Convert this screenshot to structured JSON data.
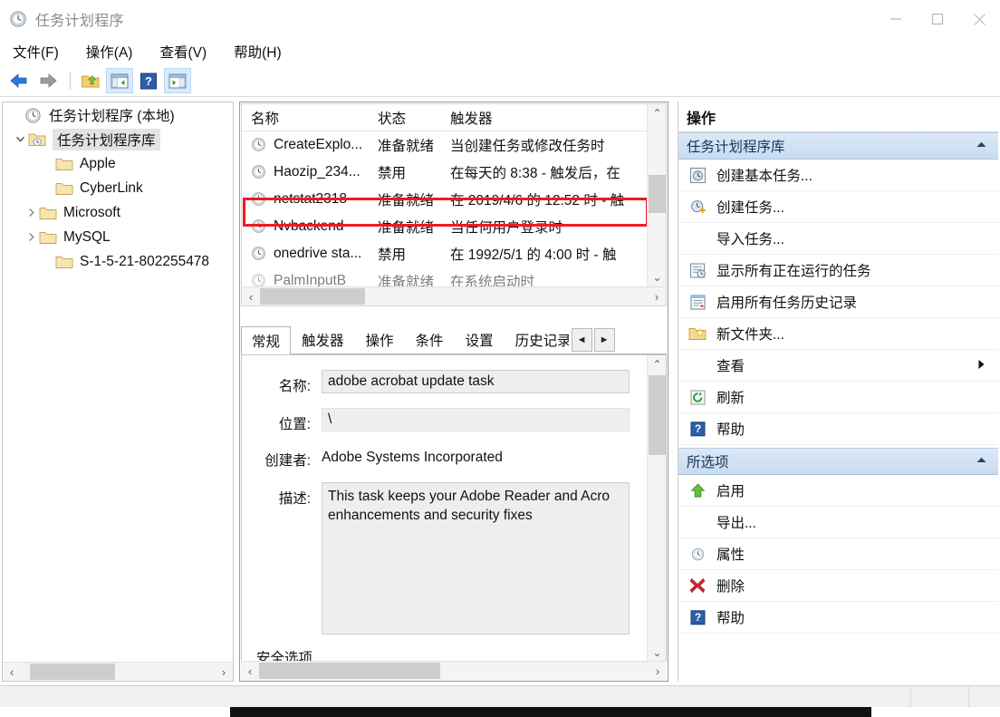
{
  "window": {
    "title": "任务计划程序",
    "title_icon": "clock-icon",
    "minimize_label": "最小化",
    "maximize_label": "最大化",
    "close_label": "关闭"
  },
  "menubar": {
    "items": [
      {
        "label": "文件(F)",
        "name": "menu-file"
      },
      {
        "label": "操作(A)",
        "name": "menu-action"
      },
      {
        "label": "查看(V)",
        "name": "menu-view"
      },
      {
        "label": "帮助(H)",
        "name": "menu-help"
      }
    ]
  },
  "toolbar": {
    "buttons": [
      {
        "icon": "back-arrow-icon",
        "name": "toolbar-back",
        "selected": false
      },
      {
        "icon": "forward-arrow-icon",
        "name": "toolbar-forward",
        "selected": false
      },
      {
        "icon": "up-folder-icon",
        "name": "toolbar-up-folder",
        "selected": false
      },
      {
        "icon": "show-hide-tree-icon",
        "name": "toolbar-show-tree",
        "selected": true
      },
      {
        "icon": "help-icon",
        "name": "toolbar-help",
        "selected": false
      },
      {
        "icon": "show-action-pane-icon",
        "name": "toolbar-action-pane",
        "selected": true
      }
    ]
  },
  "tree": {
    "nodes": [
      {
        "label": "任务计划程序 (本地)",
        "icon": "clock-icon",
        "indent": 0,
        "twisty": "",
        "selected": false
      },
      {
        "label": "任务计划程序库",
        "icon": "task-folder-icon",
        "indent": 1,
        "twisty": "v",
        "selected": true
      },
      {
        "label": "Apple",
        "icon": "folder-icon",
        "indent": 2,
        "twisty": "",
        "selected": false
      },
      {
        "label": "CyberLink",
        "icon": "folder-icon",
        "indent": 2,
        "twisty": "",
        "selected": false
      },
      {
        "label": "Microsoft",
        "icon": "folder-icon",
        "indent": 2,
        "twisty": ">",
        "selected": false
      },
      {
        "label": "MySQL",
        "icon": "folder-icon",
        "indent": 2,
        "twisty": ">",
        "selected": false
      },
      {
        "label": "S-1-5-21-802255478",
        "icon": "folder-icon",
        "indent": 2,
        "twisty": "",
        "selected": false
      }
    ],
    "hscroll": {
      "left_arrow": "‹",
      "right_arrow": "›"
    }
  },
  "task_list": {
    "columns": [
      "名称",
      "状态",
      "触发器"
    ],
    "rows": [
      {
        "name": "CreateExplo...",
        "state": "准备就绪",
        "trigger": "当创建任务或修改任务时",
        "highlighted": false
      },
      {
        "name": "Haozip_234...",
        "state": "禁用",
        "trigger": "在每天的 8:38 - 触发后，在",
        "highlighted": false
      },
      {
        "name": "netstat2318",
        "state": "准备就绪",
        "trigger": "在 2019/4/6 的 12:52 时 - 触",
        "highlighted": true
      },
      {
        "name": "Nvbackend",
        "state": "准备就绪",
        "trigger": "当任何用户登录时",
        "highlighted": false
      },
      {
        "name": "onedrive sta...",
        "state": "禁用",
        "trigger": "在 1992/5/1 的 4:00 时 - 触",
        "highlighted": false
      },
      {
        "name": "PalmInputB",
        "state": "准备就绪",
        "trigger": "在系统启动时",
        "highlighted": false
      }
    ],
    "highlight_color": "#ec1c24",
    "hscroll": {
      "left_arrow": "‹",
      "right_arrow": "›"
    },
    "vscroll": {
      "up_arrow": "⌃",
      "down_arrow": "⌄"
    }
  },
  "tabs": {
    "items": [
      {
        "label": "常规",
        "active": true
      },
      {
        "label": "触发器",
        "active": false
      },
      {
        "label": "操作",
        "active": false
      },
      {
        "label": "条件",
        "active": false
      },
      {
        "label": "设置",
        "active": false
      },
      {
        "label": "历史记录",
        "active": false,
        "clipped": true
      }
    ],
    "prev_arrow": "◄",
    "next_arrow": "►"
  },
  "detail": {
    "fields": [
      {
        "label": "名称:",
        "value": "adobe acrobat update task",
        "type": "input"
      },
      {
        "label": "位置:",
        "value": "\\",
        "type": "input"
      },
      {
        "label": "创建者:",
        "value": "Adobe Systems Incorporated",
        "type": "static"
      },
      {
        "label": "描述:",
        "value": "This task keeps your Adobe Reader and Acro\nenhancements and security fixes",
        "type": "textarea"
      }
    ],
    "section_below": "安全选项",
    "hscroll": {
      "left_arrow": "‹",
      "right_arrow": "›"
    },
    "vscroll": {
      "up_arrow": "⌃",
      "down_arrow": "⌄"
    }
  },
  "actions": {
    "title": "操作",
    "groups": [
      {
        "header": "任务计划程序库",
        "collapse_icon": "caret-up-icon",
        "items": [
          {
            "label": "创建基本任务...",
            "icon": "basic-task-icon",
            "submenu": false
          },
          {
            "label": "创建任务...",
            "icon": "create-task-icon",
            "submenu": false
          },
          {
            "label": "导入任务...",
            "icon": "none",
            "submenu": false
          },
          {
            "label": "显示所有正在运行的任务",
            "icon": "running-tasks-icon",
            "submenu": false
          },
          {
            "label": "启用所有任务历史记录",
            "icon": "task-history-icon",
            "submenu": false
          },
          {
            "label": "新文件夹...",
            "icon": "new-folder-icon",
            "submenu": false
          },
          {
            "label": "查看",
            "icon": "none",
            "submenu": true,
            "submenu_arrow": "►"
          },
          {
            "label": "刷新",
            "icon": "refresh-icon",
            "submenu": false
          },
          {
            "label": "帮助",
            "icon": "help-icon",
            "submenu": false
          }
        ]
      },
      {
        "header": "所选项",
        "collapse_icon": "caret-up-icon",
        "items": [
          {
            "label": "启用",
            "icon": "green-up-arrow-icon",
            "submenu": false
          },
          {
            "label": "导出...",
            "icon": "none",
            "submenu": false
          },
          {
            "label": "属性",
            "icon": "properties-clock-icon",
            "submenu": false
          },
          {
            "label": "删除",
            "icon": "red-x-icon",
            "submenu": false
          },
          {
            "label": "帮助",
            "icon": "help-icon",
            "submenu": false
          }
        ]
      }
    ]
  }
}
